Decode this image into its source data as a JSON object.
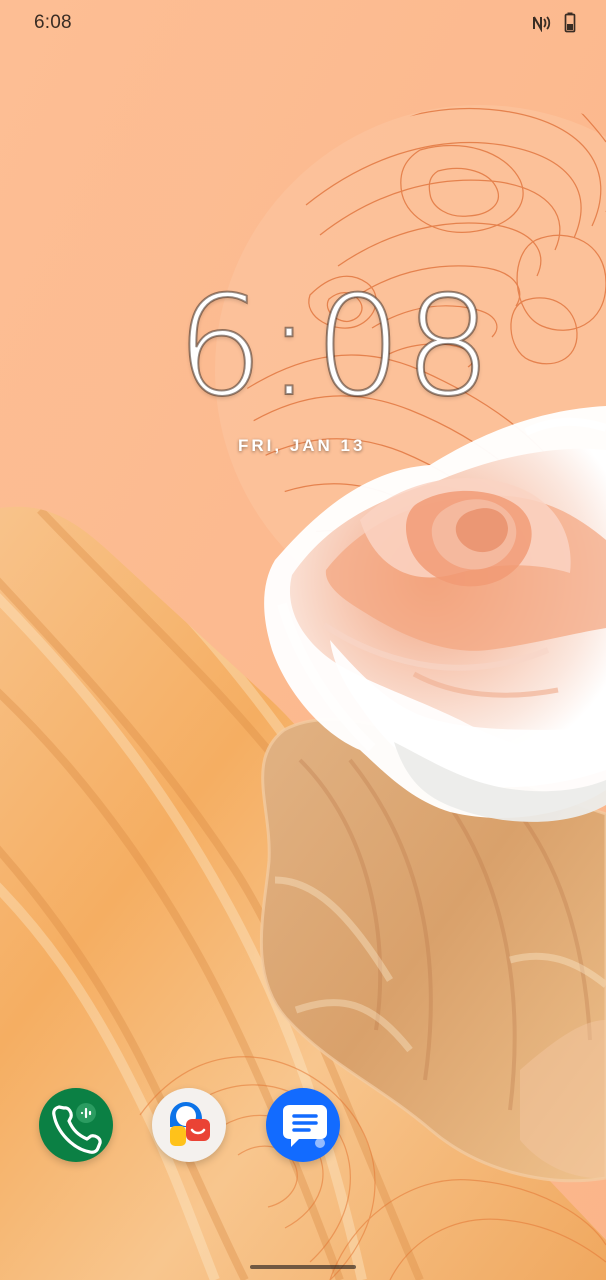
{
  "status_bar": {
    "time": "6:08",
    "icons": [
      "nfc-icon",
      "battery-icon"
    ]
  },
  "lock_screen": {
    "clock": "6:08",
    "date": "FRI, JAN 13"
  },
  "dock": {
    "apps": [
      "phone-app-icon",
      "contacts-app-icon",
      "messages-app-icon"
    ]
  },
  "colors": {
    "background": "#FDBF95",
    "contour_lines": "#D96B36",
    "wood": "#F1B46F",
    "rose": "#F3C1A5",
    "phone": "#0B8044",
    "messages": "#126BFF"
  }
}
